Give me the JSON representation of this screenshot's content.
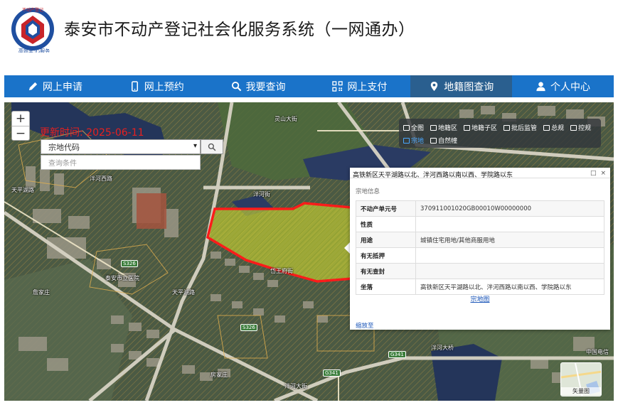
{
  "header": {
    "title": "泰安市不动产登记社会化服务系统（一网通办）",
    "logo_text_top": "不动产登记",
    "logo_text_bottom": "高效率·心服务"
  },
  "nav": {
    "items": [
      {
        "label": "网上申请",
        "icon": "pencil-icon"
      },
      {
        "label": "网上预约",
        "icon": "mobile-icon"
      },
      {
        "label": "我要查询",
        "icon": "search-icon"
      },
      {
        "label": "网上支付",
        "icon": "qrcode-icon"
      },
      {
        "label": "地籍图查询",
        "icon": "map-marker-icon",
        "active": true
      },
      {
        "label": "个人中心",
        "icon": "user-icon"
      }
    ],
    "colors": {
      "bar": "#1a73c9",
      "active": "#2a5f8f"
    }
  },
  "map": {
    "update_time": "更新时间: 2025-06-11",
    "search_select_value": "宗地代码",
    "search_placeholder": "查询条件",
    "zoom_in": "+",
    "zoom_out": "−",
    "layers_row1": [
      "全图",
      "地籍区",
      "地籍子区",
      "批后监管",
      "总规",
      "控规"
    ],
    "layers_row2": [
      "宗地",
      "自然幢"
    ],
    "active_layer": "宗地",
    "minimap_label": "矢量图",
    "labels": {
      "road1": "天平湖路",
      "road2": "泮河西路",
      "road3": "泮河街",
      "road4": "岱王府街",
      "road5": "泮河大街",
      "road6": "泮河大桥",
      "road7": "灵山大街",
      "road8": "天平湖路",
      "place1": "泰安市立医院",
      "place2": "詹家庄",
      "place3": "房家庄",
      "place4": "中国电信",
      "shield1": "S326",
      "shield2": "S326",
      "shield3": "G341",
      "shield4": "G341"
    }
  },
  "popup": {
    "title": "高铁新区天平湖路以北、泮河西路以南以西、学院路以东",
    "section": "宗地信息",
    "rows": [
      {
        "key": "不动产单元号",
        "value": "370911001020GB00010W00000000"
      },
      {
        "key": "性质",
        "value": ""
      },
      {
        "key": "用途",
        "value": "城镇住宅用地/其他商服用地"
      },
      {
        "key": "有无抵押",
        "value": ""
      },
      {
        "key": "有无查封",
        "value": ""
      },
      {
        "key": "坐落",
        "value": "高铁新区天平湖路以北、泮河西路以南以西、学院路以东"
      }
    ],
    "plot_link": "宗地图",
    "zoom_to": "缩放至"
  }
}
